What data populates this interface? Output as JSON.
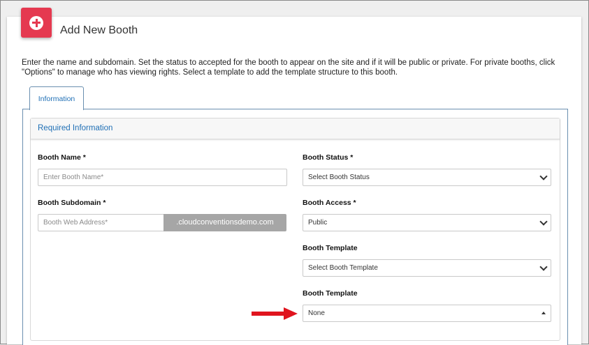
{
  "header": {
    "title": "Add New Booth"
  },
  "description": "Enter the name and subdomain. Set the status to accepted for the booth to appear on the site and if it will be public or private. For private booths, click \"Options\" to manage who has viewing rights. Select a template to add the template structure to this booth.",
  "tabs": [
    {
      "label": "Information",
      "active": true
    }
  ],
  "section": {
    "title": "Required Information"
  },
  "form": {
    "booth_name": {
      "label": "Booth Name *",
      "placeholder": "Enter Booth Name*"
    },
    "booth_subdomain": {
      "label": "Booth Subdomain *",
      "placeholder": "Booth Web Address*",
      "suffix": ".cloudconventionsdemo.com"
    },
    "booth_status": {
      "label": "Booth Status *",
      "value": "Select Booth Status"
    },
    "booth_access": {
      "label": "Booth Access *",
      "value": "Public"
    },
    "booth_template_1": {
      "label": "Booth Template",
      "value": "Select Booth Template"
    },
    "booth_template_2": {
      "label": "Booth Template",
      "value": "None"
    }
  },
  "colors": {
    "accent": "#e53950",
    "link": "#1f6fb5",
    "annotation_arrow": "#e0141e"
  },
  "icons": {
    "header": "add-circle-icon",
    "annotation": "arrow-right-icon"
  }
}
